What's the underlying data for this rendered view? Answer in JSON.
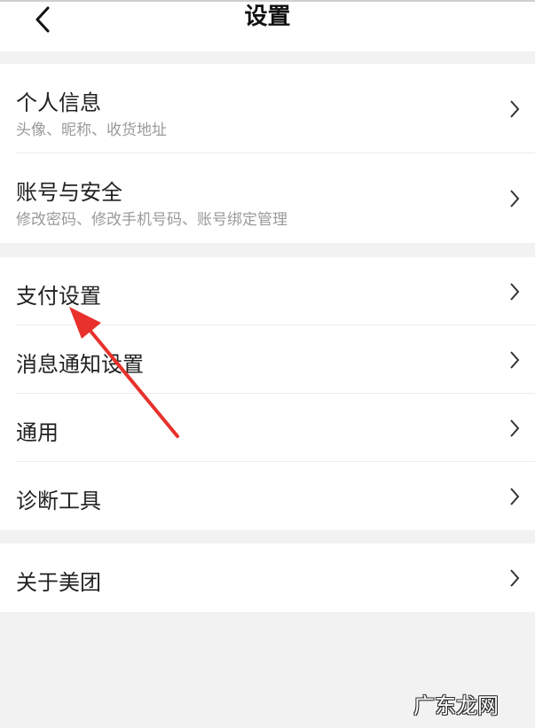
{
  "header": {
    "title": "设置",
    "back_icon": "chevron-left-icon"
  },
  "groups": [
    {
      "items": [
        {
          "title": "个人信息",
          "subtitle": "头像、昵称、收货地址"
        },
        {
          "title": "账号与安全",
          "subtitle": "修改密码、修改手机号码、账号绑定管理"
        }
      ]
    },
    {
      "items": [
        {
          "title": "支付设置"
        },
        {
          "title": "消息通知设置"
        },
        {
          "title": "通用"
        },
        {
          "title": "诊断工具"
        }
      ]
    },
    {
      "items": [
        {
          "title": "关于美团"
        }
      ]
    }
  ],
  "annotation": {
    "icon": "red-arrow-icon",
    "color": "#e8312c"
  },
  "watermark": "广东龙网",
  "colors": {
    "page_bg": "#f2f2f2",
    "row_bg": "#ffffff",
    "title": "#222222",
    "subtitle": "#9a9a9a"
  }
}
